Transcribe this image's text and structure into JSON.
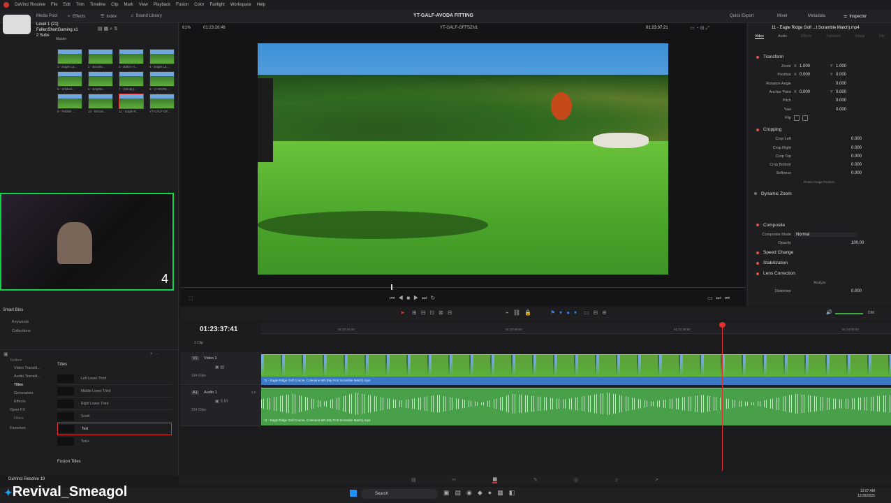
{
  "menubar": {
    "app": "DaVinci Resolve",
    "items": [
      "File",
      "Edit",
      "Trim",
      "Timeline",
      "Clip",
      "Mark",
      "View",
      "Playback",
      "Fusion",
      "Color",
      "Fairlight",
      "Workspace",
      "Help"
    ]
  },
  "titlebar": {
    "left_tabs": [
      "Media Pool",
      "Effects",
      "Index",
      "Sound Library"
    ],
    "project_title": "YT-GALF-AVODA FITTING",
    "right_tabs": [
      "Quick Export",
      "Mixer",
      "Metadata",
      "Inspector"
    ]
  },
  "overlay": {
    "level": "Level 1 (21)",
    "user": "FallenShortGaming x1",
    "subs": "2 Subs",
    "master": "Master",
    "count": "4"
  },
  "viewer_bar": {
    "zoom": "61%",
    "timecode_left": "01:23:28:46",
    "timeline_name": "YT-GALF-OFFSZN1",
    "timecode_right": "01:23:37:21"
  },
  "inspector": {
    "clip_title": "11 - Eagle Ridge Golf ...t Scramble Match).mp4",
    "tabs": [
      "Video",
      "Audio",
      "Effects",
      "Transition",
      "Image",
      "File"
    ],
    "transform": {
      "title": "Transform",
      "rows": [
        {
          "label": "Zoom",
          "a_axis": "X",
          "a": "1.000",
          "b_axis": "Y",
          "b": "1.000"
        },
        {
          "label": "Position",
          "a_axis": "X",
          "a": "0.000",
          "b_axis": "Y",
          "b": "0.000"
        },
        {
          "label": "Rotation Angle",
          "a_axis": "",
          "a": "",
          "b_axis": "",
          "b": "0.000"
        },
        {
          "label": "Anchor Point",
          "a_axis": "X",
          "a": "0.000",
          "b_axis": "Y",
          "b": "0.000"
        },
        {
          "label": "Pitch",
          "a_axis": "",
          "a": "",
          "b_axis": "",
          "b": "0.000"
        },
        {
          "label": "Yaw",
          "a_axis": "",
          "a": "",
          "b_axis": "",
          "b": "0.000"
        },
        {
          "label": "Flip",
          "a_axis": "",
          "a": "",
          "b_axis": "",
          "b": ""
        }
      ]
    },
    "cropping": {
      "title": "Cropping",
      "rows": [
        {
          "label": "Crop Left",
          "value": "0.000"
        },
        {
          "label": "Crop Right",
          "value": "0.000"
        },
        {
          "label": "Crop Top",
          "value": "0.000"
        },
        {
          "label": "Crop Bottom",
          "value": "0.000"
        },
        {
          "label": "Softness",
          "value": "0.000"
        }
      ],
      "retain": "Retain Image Position"
    },
    "dynamic_zoom": "Dynamic Zoom",
    "composite": {
      "title": "Composite",
      "mode_label": "Composite Mode",
      "mode_value": "Normal",
      "opacity_label": "Opacity",
      "opacity_value": "100.00"
    },
    "speed_change": "Speed Change",
    "stabilization": "Stabilization",
    "lens_correction": "Lens Correction",
    "analyze": "Analyze",
    "distortion_label": "Distortion",
    "distortion_value": "0.000"
  },
  "media_pool": {
    "clips": [
      "1 - Eagle La...",
      "2 - Brookv...",
      "3 - Baker H...",
      "4 - Eagle La...",
      "5 - Wildwd...",
      "6 - Brighte...",
      "7 - (Windy)...",
      "8 - (A WORL...",
      "9 - Pebble ...",
      "10 - Broom...",
      "11 - Eagle R...",
      "YT-GALF-OF..."
    ]
  },
  "smart_bins": {
    "title": "Smart Bins",
    "items": [
      "Keywords",
      "Collections"
    ]
  },
  "effects": {
    "categories": [
      "Toolbox",
      "Video Transiti...",
      "Audio Transiti...",
      "Titles",
      "Generators",
      "Effects",
      "Open FX",
      "Filters",
      "Favorites"
    ],
    "titles_header": "Titles",
    "titles": [
      "Left Lower Third",
      "Middle Lower Third",
      "Right Lower Third",
      "Scroll",
      "Text",
      "Text+"
    ],
    "fusion_titles": "Fusion Titles"
  },
  "timeline": {
    "timecode": "01:23:37:41",
    "ruler": [
      "01:22:24:00",
      "01:22:56:00",
      "01:23:28:00",
      "01:24:00:00"
    ],
    "video_track": {
      "id": "V1",
      "name": "Video 1",
      "clips": "124 Clips",
      "clip_label": "11 - Eagle Ridge Golf Course, Coleraine MN (My First Scramble Match).mp4"
    },
    "audio_track": {
      "id": "A1",
      "name": "Audio 1",
      "level": "2.0",
      "clips": "124 Clips",
      "clip_label": "11 - Eagle Ridge Golf Course, Coleraine MN (My First Scramble Match).mp4"
    },
    "clip_count": "1 Clip",
    "volume_label": "DIM"
  },
  "bottom": {
    "app_version": "DaVinci Resolve 19",
    "handle": "Revival_Smeagol",
    "search": "Search",
    "time": "12:07 AM",
    "date": "12/28/2025"
  }
}
